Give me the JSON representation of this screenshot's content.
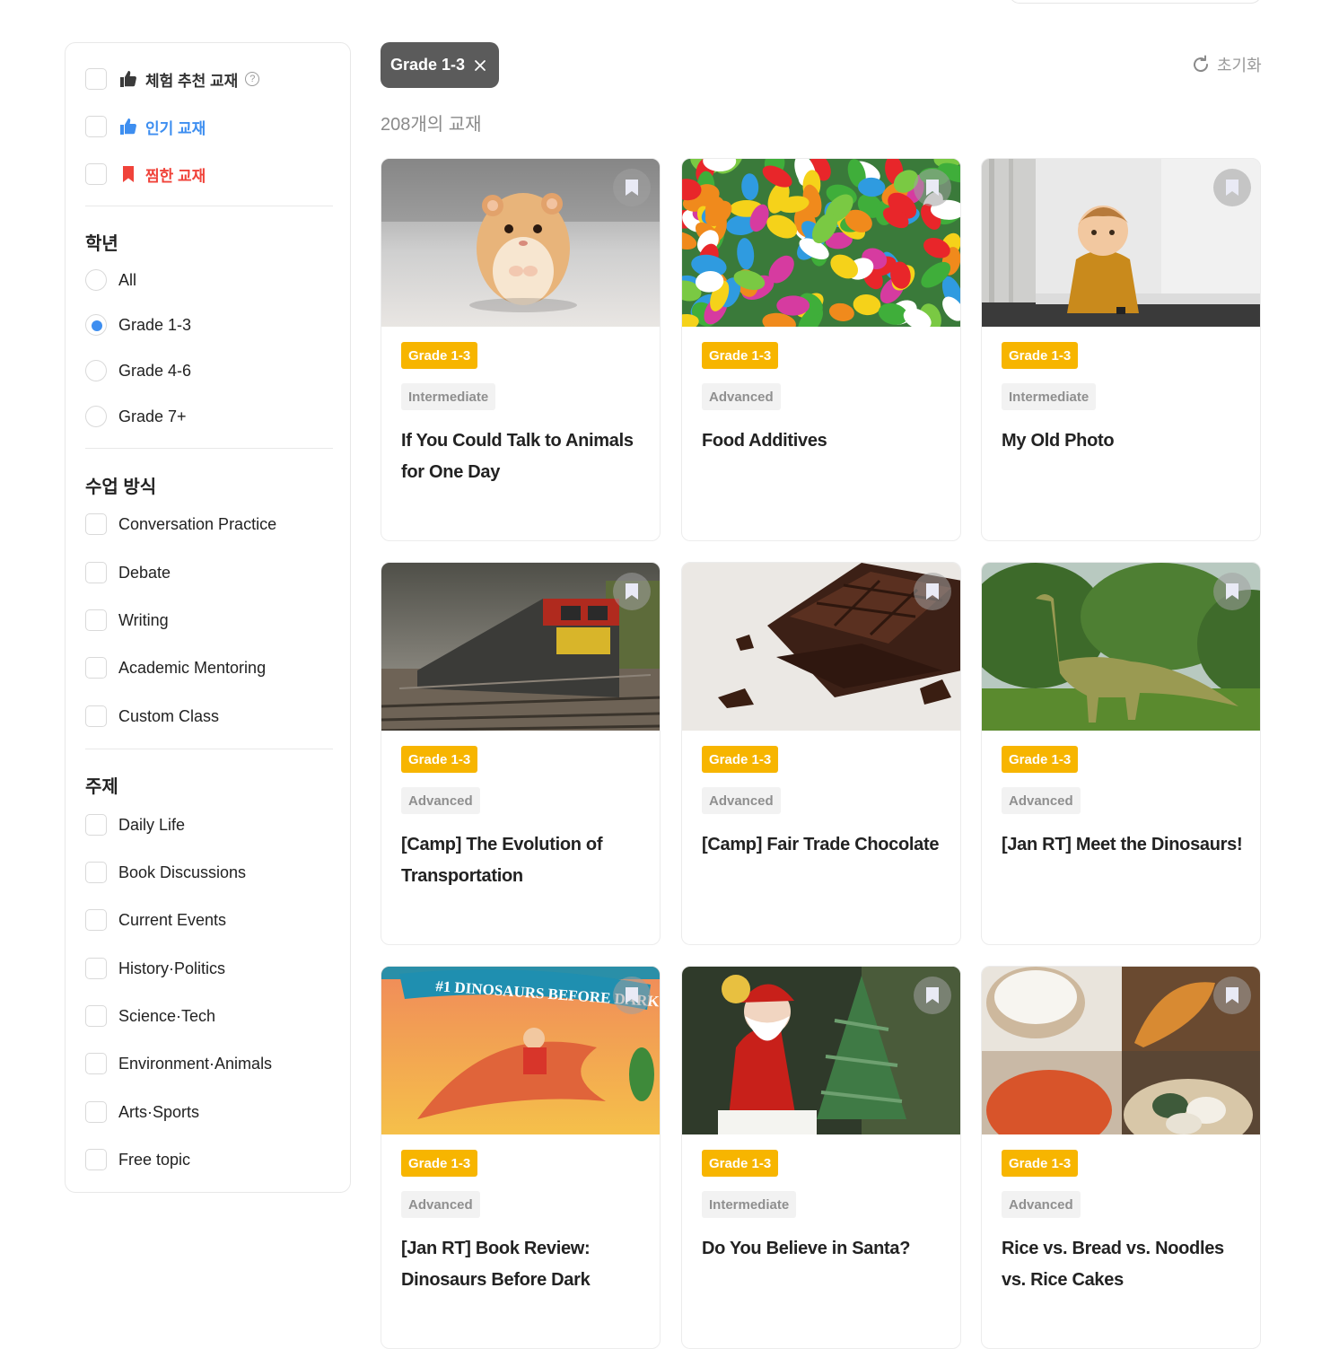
{
  "sidebar": {
    "quick_filters": [
      {
        "label": "체험 추천 교재",
        "color": "#333333"
      },
      {
        "label": "인기 교재",
        "color": "#3d8ef0"
      },
      {
        "label": "찜한 교재",
        "color": "#f0433a"
      }
    ],
    "grade": {
      "title": "학년",
      "options": [
        "All",
        "Grade 1-3",
        "Grade 4-6",
        "Grade 7+"
      ],
      "selected": "Grade 1-3"
    },
    "method": {
      "title": "수업 방식",
      "options": [
        "Conversation Practice",
        "Debate",
        "Writing",
        "Academic Mentoring",
        "Custom Class"
      ]
    },
    "topic": {
      "title": "주제",
      "options": [
        "Daily Life",
        "Book Discussions",
        "Current Events",
        "History·Politics",
        "Science·Tech",
        "Environment·Animals",
        "Arts·Sports",
        "Free topic"
      ]
    }
  },
  "filter_chip": {
    "label": "Grade 1-3"
  },
  "reset_label": "초기화",
  "result_count": "208개의 교재",
  "colors": {
    "grade_badge": "#f7b500",
    "accent_blue": "#3d8ef0",
    "accent_red": "#f0433a"
  },
  "cards": [
    {
      "grade": "Grade 1-3",
      "level": "Intermediate",
      "title": "If You Could Talk to Animals for One Day",
      "image": "hamster"
    },
    {
      "grade": "Grade 1-3",
      "level": "Advanced",
      "title": "Food Additives",
      "image": "jelly-beans"
    },
    {
      "grade": "Grade 1-3",
      "level": "Intermediate",
      "title": "My Old Photo",
      "image": "toddler"
    },
    {
      "grade": "Grade 1-3",
      "level": "Advanced",
      "title": "[Camp] The Evolution of Transportation",
      "image": "freight-train"
    },
    {
      "grade": "Grade 1-3",
      "level": "Advanced",
      "title": "[Camp] Fair Trade Chocolate",
      "image": "chocolate"
    },
    {
      "grade": "Grade 1-3",
      "level": "Advanced",
      "title": "[Jan RT] Meet the Dinosaurs!",
      "image": "dinosaur-statue"
    },
    {
      "grade": "Grade 1-3",
      "level": "Advanced",
      "title": "[Jan RT] Book Review: Dinosaurs Before Dark",
      "image": "book-cover",
      "image_text": "#1 DINOSAURS BEFORE DARK"
    },
    {
      "grade": "Grade 1-3",
      "level": "Intermediate",
      "title": "Do You Believe in Santa?",
      "image": "santa"
    },
    {
      "grade": "Grade 1-3",
      "level": "Advanced",
      "title": "Rice vs. Bread vs. Noodles vs. Rice Cakes",
      "image": "staple-foods"
    }
  ]
}
